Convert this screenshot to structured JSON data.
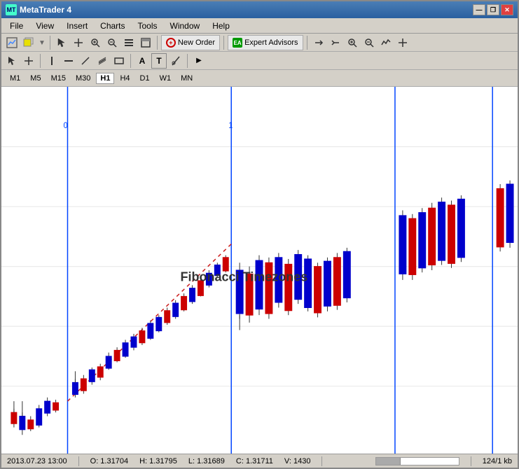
{
  "window": {
    "title": "MetaTrader 4",
    "icon": "MT"
  },
  "title_controls": {
    "minimize": "—",
    "restore": "❐",
    "close": "✕"
  },
  "menu": {
    "items": [
      "File",
      "View",
      "Insert",
      "Charts",
      "Tools",
      "Window",
      "Help"
    ]
  },
  "toolbar": {
    "new_order_label": "New Order",
    "expert_advisors_label": "Expert Advisors"
  },
  "timeframes": {
    "items": [
      "M1",
      "M5",
      "M15",
      "M30",
      "H1",
      "H4",
      "D1",
      "W1",
      "MN"
    ],
    "active": "H1"
  },
  "chart": {
    "fib_label": "Fibonacci Timezones",
    "label0": "0",
    "label1": "1"
  },
  "status": {
    "datetime": "2013.07.23 13:00",
    "open": "O: 1.31704",
    "high": "H: 1.31795",
    "low": "L: 1.31689",
    "close": "C: 1.31711",
    "volume": "V: 1430",
    "memory": "124/1 kb"
  }
}
